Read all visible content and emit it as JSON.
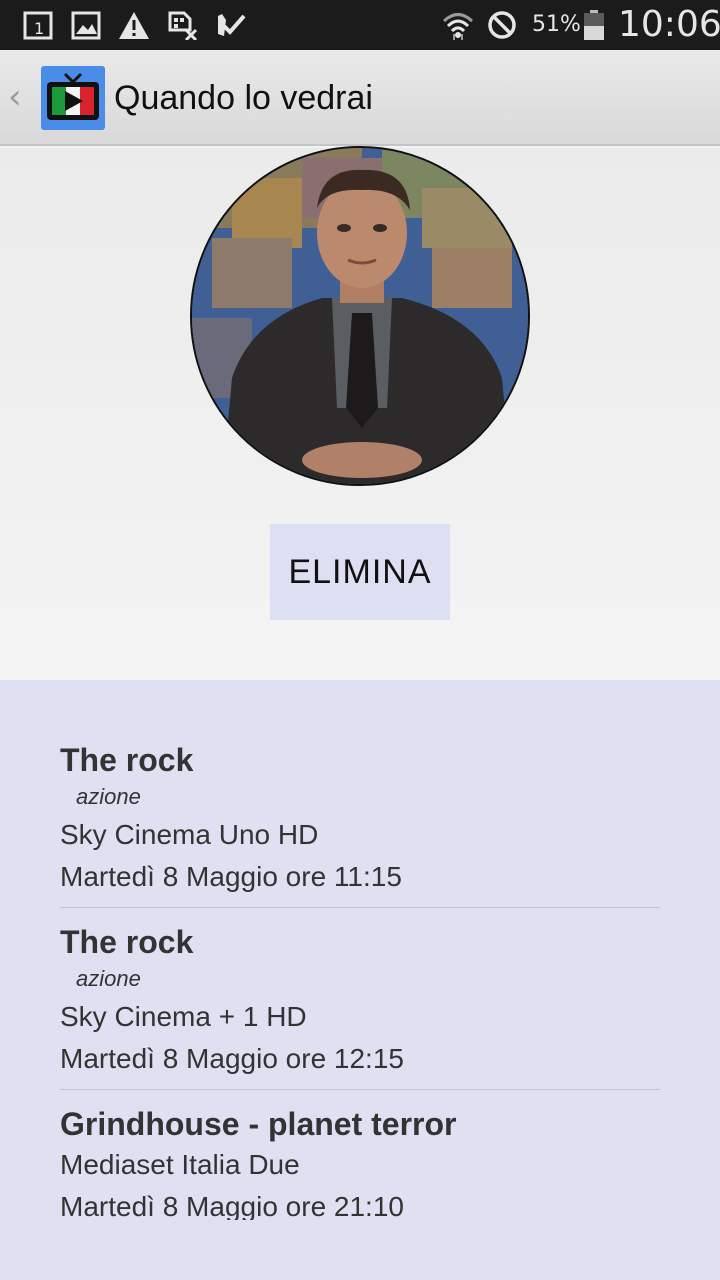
{
  "status_bar": {
    "battery_percent": "51%",
    "time": "10:06",
    "icons": [
      "calendar-icon",
      "gallery-icon",
      "warning-icon",
      "sim-blocked-icon",
      "task-done-icon",
      "wifi-icon",
      "blocked-icon",
      "battery-icon"
    ]
  },
  "action_bar": {
    "title": "Quando lo vedrai",
    "back_icon": "chevron-left-icon",
    "app_icon": "tv-italy-icon"
  },
  "profile": {
    "avatar_icon": "actor-avatar",
    "delete_label": "ELIMINA"
  },
  "listings": [
    {
      "title": "The rock",
      "genre": "azione",
      "channel": "Sky Cinema Uno HD",
      "datetime": "Martedì 8 Maggio ore 11:15"
    },
    {
      "title": "The rock",
      "genre": "azione",
      "channel": "Sky Cinema + 1 HD",
      "datetime": "Martedì 8 Maggio ore 12:15"
    },
    {
      "title": "Grindhouse - planet terror",
      "genre": "",
      "channel": "Mediaset Italia Due",
      "datetime": "Martedì 8 Maggio ore 21:10"
    }
  ],
  "colors": {
    "status_bar_bg": "#1b1b1b",
    "action_bar_bg": "#e0e0e0",
    "list_bg": "#dfe1f2",
    "button_bg": "#dde0f2",
    "app_icon_bg": "#4a8de8"
  }
}
